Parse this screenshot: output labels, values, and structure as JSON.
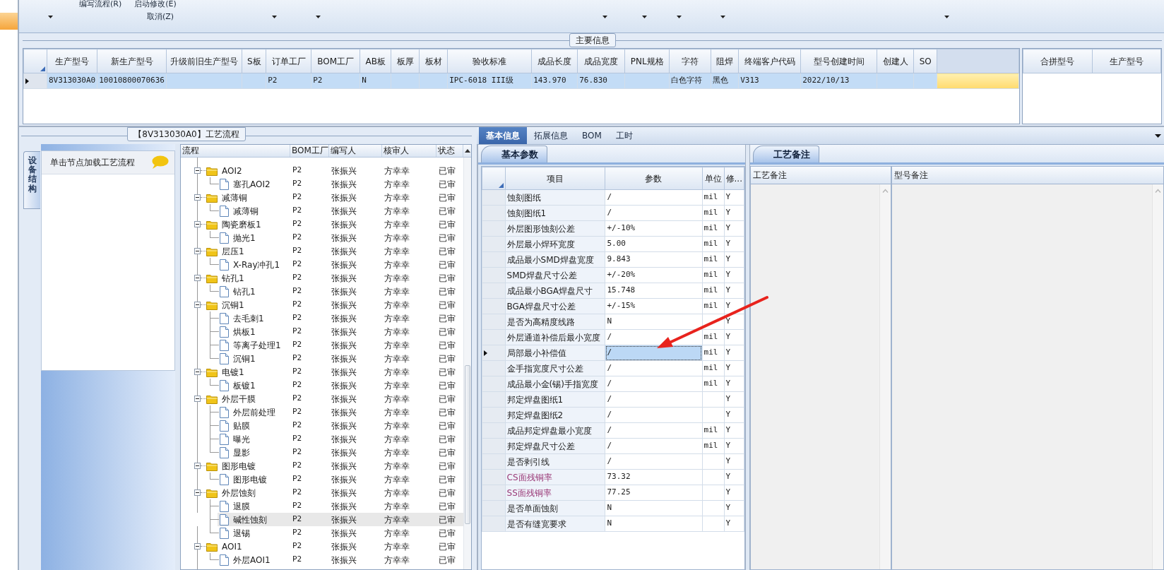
{
  "toolbar": {
    "menu_items": [
      "编写流程(R)",
      "启动修改(E)",
      "取消(Z)"
    ]
  },
  "main_info": {
    "title": "主要信息",
    "columns": [
      "生产型号",
      "新生产型号",
      "升级前旧生产型号",
      "S板",
      "订单工厂",
      "BOM工厂",
      "AB板",
      "板厚",
      "板材",
      "验收标准",
      "成品长度",
      "成品宽度",
      "PNL规格",
      "字符",
      "阻焊",
      "终端客户代码",
      "型号创建时间",
      "创建人",
      "SO"
    ],
    "rows": [
      {
        "current": true,
        "cells": [
          "8V313030A0",
          "10010800070636",
          null,
          null,
          "P2",
          "P2",
          "N",
          null,
          null,
          "IPC-6018 III级",
          "143.970",
          "76.830",
          null,
          "白色字符",
          "黑色",
          "V313",
          "2022/10/13",
          null,
          null
        ]
      }
    ],
    "merge_grid": {
      "columns": [
        "合拼型号",
        "生产型号"
      ]
    }
  },
  "process_flow": {
    "title": "【8V313030A0】工艺流程",
    "side_tab": "设备结构",
    "hint": "单击节点加载工艺流程",
    "columns": [
      "流程",
      "BOM工厂",
      "编写人",
      "核审人",
      "状态"
    ],
    "nodes": [
      {
        "label": "AOI2",
        "bom_factory": "P2",
        "writer": "张振兴",
        "reviewer": "方幸幸",
        "status": "已审",
        "expanded": true,
        "selected": false,
        "children": [
          {
            "label": "塞孔AOI2",
            "bom_factory": "P2",
            "writer": "张振兴",
            "reviewer": "方幸幸",
            "status": "已审",
            "selected": false
          }
        ]
      },
      {
        "label": "减薄铜",
        "bom_factory": "P2",
        "writer": "张振兴",
        "reviewer": "方幸幸",
        "status": "已审",
        "expanded": true,
        "selected": false,
        "children": [
          {
            "label": "减薄铜",
            "bom_factory": "P2",
            "writer": "张振兴",
            "reviewer": "方幸幸",
            "status": "已审",
            "selected": false
          }
        ]
      },
      {
        "label": "陶瓷磨板1",
        "bom_factory": "P2",
        "writer": "张振兴",
        "reviewer": "方幸幸",
        "status": "已审",
        "expanded": true,
        "selected": false,
        "children": [
          {
            "label": "抛光1",
            "bom_factory": "P2",
            "writer": "张振兴",
            "reviewer": "方幸幸",
            "status": "已审",
            "selected": false
          }
        ]
      },
      {
        "label": "层压1",
        "bom_factory": "P2",
        "writer": "张振兴",
        "reviewer": "方幸幸",
        "status": "已审",
        "expanded": true,
        "selected": false,
        "children": [
          {
            "label": "X-Ray冲孔1",
            "bom_factory": "P2",
            "writer": "张振兴",
            "reviewer": "方幸幸",
            "status": "已审",
            "selected": false
          }
        ]
      },
      {
        "label": "钻孔1",
        "bom_factory": "P2",
        "writer": "张振兴",
        "reviewer": "方幸幸",
        "status": "已审",
        "expanded": true,
        "selected": false,
        "children": [
          {
            "label": "钻孔1",
            "bom_factory": "P2",
            "writer": "张振兴",
            "reviewer": "方幸幸",
            "status": "已审",
            "selected": false
          }
        ]
      },
      {
        "label": "沉铜1",
        "bom_factory": "P2",
        "writer": "张振兴",
        "reviewer": "方幸幸",
        "status": "已审",
        "expanded": true,
        "selected": false,
        "children": [
          {
            "label": "去毛刺1",
            "bom_factory": "P2",
            "writer": "张振兴",
            "reviewer": "方幸幸",
            "status": "已审",
            "selected": false
          },
          {
            "label": "烘板1",
            "bom_factory": "P2",
            "writer": "张振兴",
            "reviewer": "方幸幸",
            "status": "已审",
            "selected": false
          },
          {
            "label": "等离子处理1",
            "bom_factory": "P2",
            "writer": "张振兴",
            "reviewer": "方幸幸",
            "status": "已审",
            "selected": false
          },
          {
            "label": "沉铜1",
            "bom_factory": "P2",
            "writer": "张振兴",
            "reviewer": "方幸幸",
            "status": "已审",
            "selected": false
          }
        ]
      },
      {
        "label": "电镀1",
        "bom_factory": "P2",
        "writer": "张振兴",
        "reviewer": "方幸幸",
        "status": "已审",
        "expanded": true,
        "selected": false,
        "children": [
          {
            "label": "板镀1",
            "bom_factory": "P2",
            "writer": "张振兴",
            "reviewer": "方幸幸",
            "status": "已审",
            "selected": false
          }
        ]
      },
      {
        "label": "外层干膜",
        "bom_factory": "P2",
        "writer": "张振兴",
        "reviewer": "方幸幸",
        "status": "已审",
        "expanded": true,
        "selected": false,
        "children": [
          {
            "label": "外层前处理",
            "bom_factory": "P2",
            "writer": "张振兴",
            "reviewer": "方幸幸",
            "status": "已审",
            "selected": false
          },
          {
            "label": "贴膜",
            "bom_factory": "P2",
            "writer": "张振兴",
            "reviewer": "方幸幸",
            "status": "已审",
            "selected": false
          },
          {
            "label": "曝光",
            "bom_factory": "P2",
            "writer": "张振兴",
            "reviewer": "方幸幸",
            "status": "已审",
            "selected": false
          },
          {
            "label": "显影",
            "bom_factory": "P2",
            "writer": "张振兴",
            "reviewer": "方幸幸",
            "status": "已审",
            "selected": false
          }
        ]
      },
      {
        "label": "图形电镀",
        "bom_factory": "P2",
        "writer": "张振兴",
        "reviewer": "方幸幸",
        "status": "已审",
        "expanded": true,
        "selected": false,
        "children": [
          {
            "label": "图形电镀",
            "bom_factory": "P2",
            "writer": "张振兴",
            "reviewer": "方幸幸",
            "status": "已审",
            "selected": false
          }
        ]
      },
      {
        "label": "外层蚀刻",
        "bom_factory": "P2",
        "writer": "张振兴",
        "reviewer": "方幸幸",
        "status": "已审",
        "expanded": true,
        "selected": false,
        "children": [
          {
            "label": "退膜",
            "bom_factory": "P2",
            "writer": "张振兴",
            "reviewer": "方幸幸",
            "status": "已审",
            "selected": false
          },
          {
            "label": "碱性蚀刻",
            "bom_factory": "P2",
            "writer": "张振兴",
            "reviewer": "方幸幸",
            "status": "已审",
            "selected": true
          },
          {
            "label": "退锡",
            "bom_factory": "P2",
            "writer": "张振兴",
            "reviewer": "方幸幸",
            "status": "已审",
            "selected": false
          }
        ]
      },
      {
        "label": "AOI1",
        "bom_factory": "P2",
        "writer": "张振兴",
        "reviewer": "方幸幸",
        "status": "已审",
        "expanded": true,
        "selected": false,
        "children": [
          {
            "label": "外层AOI1",
            "bom_factory": "P2",
            "writer": "张振兴",
            "reviewer": "方幸幸",
            "status": "已审",
            "selected": false
          }
        ]
      }
    ]
  },
  "detail": {
    "tabs": [
      {
        "label": "基本信息",
        "selected": true
      },
      {
        "label": "拓展信息",
        "selected": false
      },
      {
        "label": "BOM",
        "selected": false
      },
      {
        "label": "工时",
        "selected": false
      }
    ],
    "basic_params": {
      "tab": "基本参数",
      "columns": [
        "项目",
        "参数",
        "单位",
        "修..."
      ],
      "rows": [
        {
          "item": "蚀刻图纸",
          "value": "/",
          "unit": "mil",
          "flag": "Y",
          "current": false
        },
        {
          "item": "蚀刻图纸1",
          "value": "/",
          "unit": "mil",
          "flag": "Y",
          "current": false
        },
        {
          "item": "外层图形蚀刻公差",
          "value": "+/-10%",
          "unit": "mil",
          "flag": "Y",
          "current": false
        },
        {
          "item": "外层最小焊环宽度",
          "value": "5.00",
          "unit": "mil",
          "flag": "Y",
          "current": false
        },
        {
          "item": "成品最小SMD焊盘宽度",
          "value": "9.843",
          "unit": "mil",
          "flag": "Y",
          "current": false
        },
        {
          "item": "SMD焊盘尺寸公差",
          "value": "+/-20%",
          "unit": "mil",
          "flag": "Y",
          "current": false
        },
        {
          "item": "成品最小BGA焊盘尺寸",
          "value": "15.748",
          "unit": "mil",
          "flag": "Y",
          "current": false
        },
        {
          "item": "BGA焊盘尺寸公差",
          "value": "+/-15%",
          "unit": "mil",
          "flag": "Y",
          "current": false
        },
        {
          "item": "是否为高精度线路",
          "value": "N",
          "flag": "Y",
          "current": false
        },
        {
          "item": "外层通道补偿后最小宽度",
          "value": "/",
          "unit": "mil",
          "flag": "Y",
          "current": false
        },
        {
          "item": "局部最小补偿值",
          "value": "/",
          "unit": "mil",
          "flag": "Y",
          "current": true
        },
        {
          "item": "金手指宽度尺寸公差",
          "value": "/",
          "unit": "mil",
          "flag": "Y",
          "current": false
        },
        {
          "item": "成品最小金(锡)手指宽度",
          "value": "/",
          "unit": "mil",
          "flag": "Y",
          "current": false
        },
        {
          "item": "邦定焊盘图纸1",
          "value": "/",
          "flag": "Y",
          "current": false
        },
        {
          "item": "邦定焊盘图纸2",
          "value": "/",
          "flag": "Y",
          "current": false
        },
        {
          "item": "成品邦定焊盘最小宽度",
          "value": "/",
          "unit": "mil",
          "flag": "Y",
          "current": false
        },
        {
          "item": "邦定焊盘尺寸公差",
          "value": "/",
          "unit": "mil",
          "flag": "Y",
          "current": false
        },
        {
          "item": "是否剥引线",
          "value": "/",
          "flag": "Y",
          "current": false
        },
        {
          "item": "CS面残铜率",
          "value": "73.32",
          "flag": "Y",
          "current": false,
          "color": "#9a3a78"
        },
        {
          "item": "SS面残铜率",
          "value": "77.25",
          "flag": "Y",
          "current": false,
          "color": "#9a3a78"
        },
        {
          "item": "是否单面蚀刻",
          "value": "N",
          "flag": "Y",
          "current": false
        },
        {
          "item": "是否有缝宽要求",
          "value": "N",
          "flag": "Y",
          "current": false
        }
      ]
    },
    "notes": {
      "tab": "工艺备注",
      "columns": [
        "工艺备注",
        "型号备注"
      ]
    }
  }
}
